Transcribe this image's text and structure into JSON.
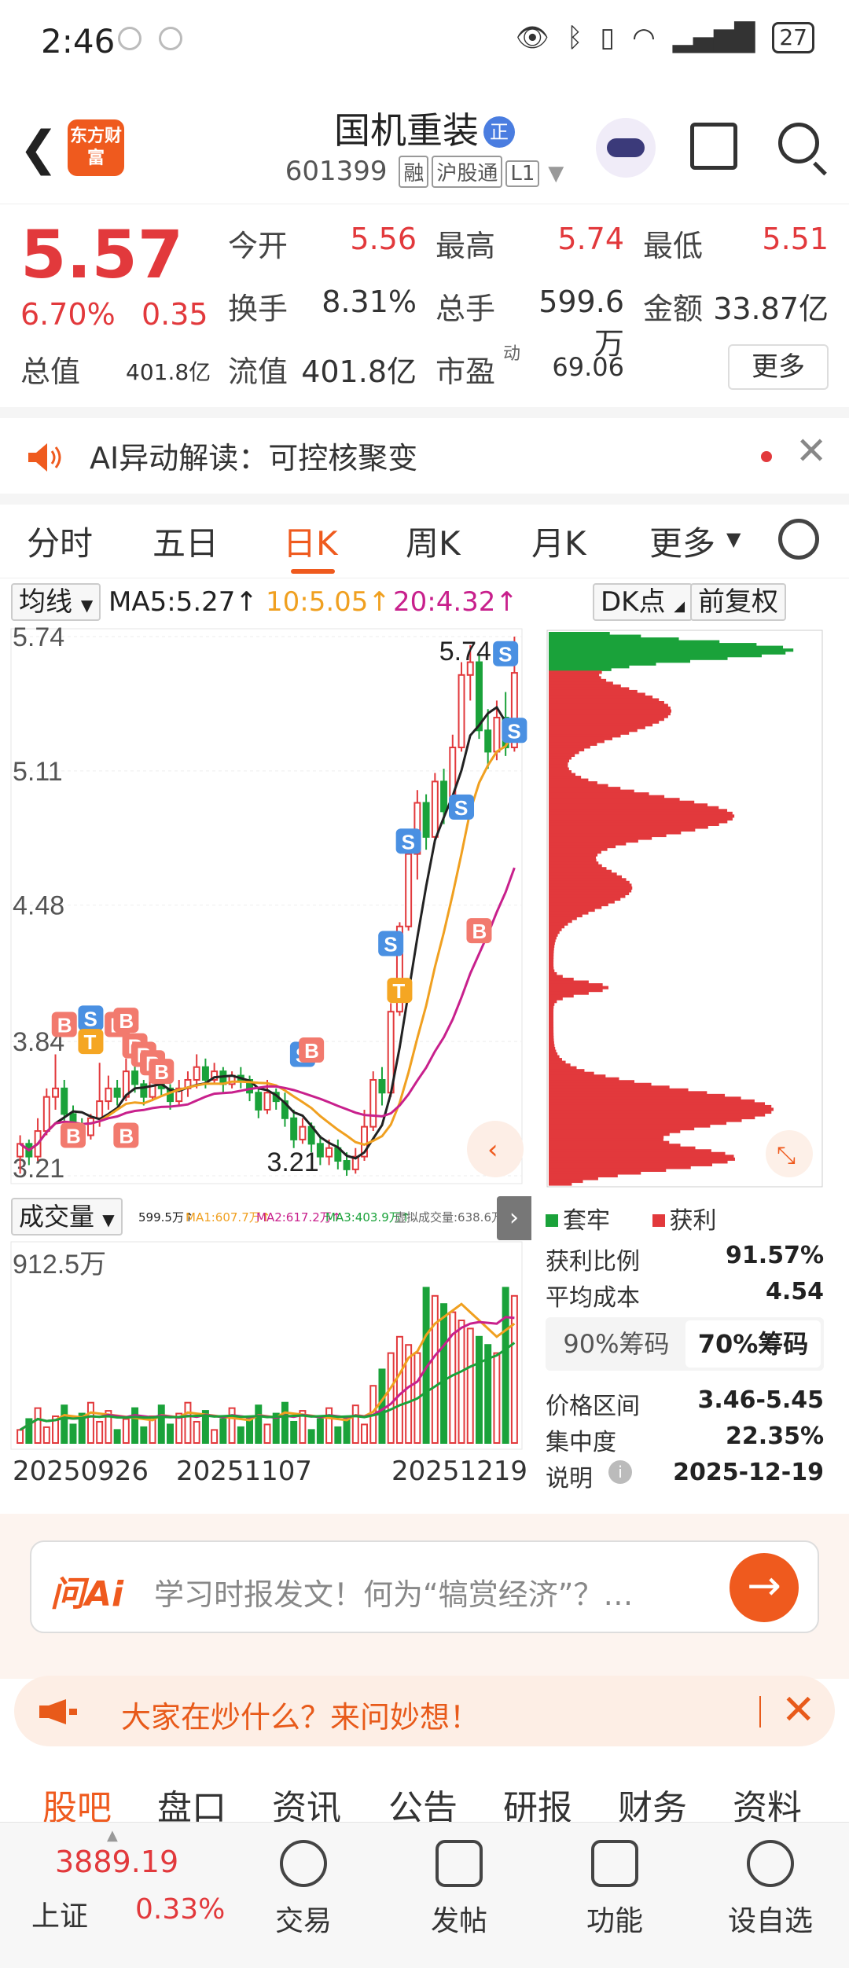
{
  "status": {
    "time": "2:46",
    "battery": "27"
  },
  "header": {
    "logo_text": "东方财富",
    "title": "国机重装",
    "title_badge": "正",
    "code": "601399",
    "tags": [
      "融",
      "沪股通",
      "L1"
    ]
  },
  "quote": {
    "price": "5.57",
    "change_pct": "6.70%",
    "change": "0.35",
    "total_value_label": "总值",
    "total_value": "401.8亿",
    "fields": [
      {
        "label": "今开",
        "value": "5.56"
      },
      {
        "label": "最高",
        "value": "5.74"
      },
      {
        "label": "最低",
        "value": "5.51"
      },
      {
        "label": "换手",
        "value": "8.31%"
      },
      {
        "label": "总手",
        "value": "599.6万"
      },
      {
        "label": "金额",
        "value": "33.87亿"
      },
      {
        "label": "流值",
        "value": "401.8亿"
      },
      {
        "label": "市盈",
        "value": "69.06"
      }
    ],
    "pe_superscript": "动",
    "more_label": "更多"
  },
  "ai_banner": {
    "text": "AI异动解读：可控核聚变"
  },
  "period_tabs": [
    "分时",
    "五日",
    "日K",
    "周K",
    "月K",
    "更多"
  ],
  "active_period": "日K",
  "ma_row": {
    "selector": "均线",
    "ma5": "MA5:5.27↑",
    "ma10": "10:5.05↑",
    "ma20": "20:4.32↑",
    "dk_label": "DK点",
    "adjust_label": "前复权"
  },
  "colors": {
    "up": "#e2393c",
    "down": "#1aa23a",
    "accent": "#ef5a1e",
    "ma5": "#222222",
    "ma10": "#f0a020",
    "ma20": "#c8208c"
  },
  "kline": {
    "y_labels": [
      "5.74",
      "5.11",
      "4.48",
      "3.84",
      "3.21"
    ],
    "high_label": "5.74",
    "low_label": "3.21",
    "candles": [
      [
        3.3,
        3.36,
        3.22,
        3.4
      ],
      [
        3.36,
        3.3,
        3.26,
        3.38
      ],
      [
        3.3,
        3.42,
        3.28,
        3.48
      ],
      [
        3.42,
        3.58,
        3.4,
        3.62
      ],
      [
        3.58,
        3.62,
        3.52,
        3.78
      ],
      [
        3.62,
        3.5,
        3.46,
        3.66
      ],
      [
        3.5,
        3.44,
        3.4,
        3.54
      ],
      [
        3.44,
        3.4,
        3.36,
        3.48
      ],
      [
        3.4,
        3.48,
        3.38,
        3.5
      ],
      [
        3.48,
        3.56,
        3.44,
        3.74
      ],
      [
        3.56,
        3.62,
        3.52,
        3.68
      ],
      [
        3.62,
        3.58,
        3.54,
        3.66
      ],
      [
        3.58,
        3.7,
        3.56,
        3.76
      ],
      [
        3.7,
        3.64,
        3.6,
        3.74
      ],
      [
        3.64,
        3.58,
        3.54,
        3.66
      ],
      [
        3.58,
        3.66,
        3.56,
        3.7
      ],
      [
        3.66,
        3.62,
        3.58,
        3.7
      ],
      [
        3.62,
        3.56,
        3.52,
        3.64
      ],
      [
        3.56,
        3.62,
        3.54,
        3.66
      ],
      [
        3.62,
        3.66,
        3.58,
        3.7
      ],
      [
        3.66,
        3.72,
        3.62,
        3.78
      ],
      [
        3.72,
        3.66,
        3.62,
        3.76
      ],
      [
        3.66,
        3.7,
        3.64,
        3.74
      ],
      [
        3.7,
        3.64,
        3.6,
        3.72
      ],
      [
        3.64,
        3.68,
        3.62,
        3.7
      ],
      [
        3.68,
        3.66,
        3.62,
        3.72
      ],
      [
        3.66,
        3.6,
        3.56,
        3.68
      ],
      [
        3.6,
        3.52,
        3.48,
        3.62
      ],
      [
        3.52,
        3.6,
        3.5,
        3.66
      ],
      [
        3.6,
        3.56,
        3.52,
        3.62
      ],
      [
        3.56,
        3.48,
        3.44,
        3.6
      ],
      [
        3.48,
        3.38,
        3.34,
        3.52
      ],
      [
        3.38,
        3.44,
        3.36,
        3.48
      ],
      [
        3.44,
        3.36,
        3.32,
        3.46
      ],
      [
        3.36,
        3.3,
        3.26,
        3.4
      ],
      [
        3.3,
        3.34,
        3.26,
        3.38
      ],
      [
        3.34,
        3.28,
        3.24,
        3.38
      ],
      [
        3.28,
        3.24,
        3.21,
        3.32
      ],
      [
        3.24,
        3.3,
        3.22,
        3.34
      ],
      [
        3.3,
        3.44,
        3.28,
        3.52
      ],
      [
        3.44,
        3.66,
        3.42,
        3.7
      ],
      [
        3.66,
        3.6,
        3.54,
        3.72
      ],
      [
        3.6,
        3.98,
        3.58,
        4.02
      ],
      [
        3.98,
        4.38,
        3.96,
        4.4
      ],
      [
        4.38,
        4.72,
        4.36,
        4.78
      ],
      [
        4.72,
        4.96,
        4.6,
        5.02
      ],
      [
        4.96,
        4.8,
        4.74,
        5.0
      ],
      [
        4.8,
        5.06,
        4.78,
        5.1
      ],
      [
        5.06,
        4.92,
        4.86,
        5.12
      ],
      [
        4.92,
        5.22,
        4.9,
        5.28
      ],
      [
        5.22,
        5.56,
        5.2,
        5.62
      ],
      [
        5.56,
        5.62,
        5.44,
        5.7
      ],
      [
        5.62,
        5.3,
        5.26,
        5.66
      ],
      [
        5.3,
        5.2,
        5.12,
        5.4
      ],
      [
        5.2,
        5.36,
        5.16,
        5.44
      ],
      [
        5.36,
        5.22,
        5.18,
        5.48
      ],
      [
        5.22,
        5.57,
        5.2,
        5.74
      ]
    ]
  },
  "volume": {
    "selector": "成交量",
    "legend": [
      "599.5万↑",
      "MA1:607.7万↑",
      "MA2:617.2万↑",
      "MA3:403.9万↑",
      "虚拟成交量:638.6万"
    ],
    "max_label": "912.5万",
    "dates": [
      "20250926",
      "20251107",
      "20251219"
    ]
  },
  "chips": {
    "legend_trap": "套牢",
    "legend_profit": "获利",
    "rows": [
      {
        "label": "获利比例",
        "value": "91.57%"
      },
      {
        "label": "平均成本",
        "value": "4.54"
      },
      {
        "label": "价格区间",
        "value": "3.46-5.45"
      },
      {
        "label": "集中度",
        "value": "22.35%"
      },
      {
        "label": "说明",
        "value": "2025-12-19"
      }
    ],
    "seg_90": "90%筹码",
    "seg_70": "70%筹码"
  },
  "ask_ai": {
    "brand": "问Ai",
    "placeholder": "学习时报发文！何为“犒赏经济”？…"
  },
  "hot_bar": {
    "text": "大家在炒什么？来问妙想！"
  },
  "bottom_tabs": [
    "股吧",
    "盘口",
    "资讯",
    "公告",
    "研报",
    "财务",
    "资料"
  ],
  "bottom_nav": {
    "index_value": "3889.19",
    "index_name": "上证",
    "index_change": "0.33%",
    "items": [
      "交易",
      "发帖",
      "功能",
      "设自选"
    ]
  }
}
